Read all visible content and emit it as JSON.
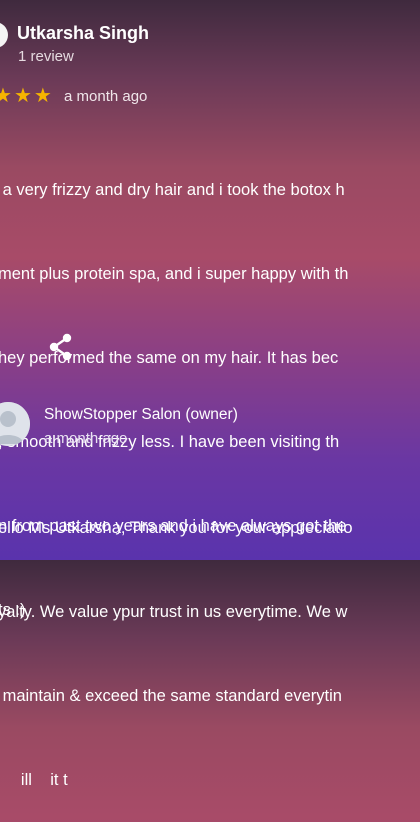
{
  "review": {
    "reviewer_name": "Utkarsha Singh",
    "reviewer_meta": "1 review",
    "rating": 5,
    "date": "a month ago",
    "text_lines": [
      " a very frizzy and dry hair and i took the botox h",
      "ment plus protein spa, and i super happy with th",
      "hey performed the same on my hair. It has bec",
      ", smooth and frizzy less. I have been visiting th",
      "n from past two years and i have always got the",
      "ts :)"
    ]
  },
  "icons": {
    "star": "star-icon",
    "share": "share-icon",
    "avatar": "person-icon"
  },
  "owner_reply": {
    "name": "ShowStopper Salon (owner)",
    "date": "a month ago",
    "text_lines": [
      "ello Ms Utkarsha, Thank you for your appreciatio",
      "yalty. We value ypur trust in us everytime. We w",
      " maintain & exceed the same standard everytin",
      "     ill    it t"
    ]
  },
  "colors": {
    "star": "#f6b400",
    "avatar_bg": "#dfe3ea",
    "avatar_fg": "#b9c1cc"
  }
}
